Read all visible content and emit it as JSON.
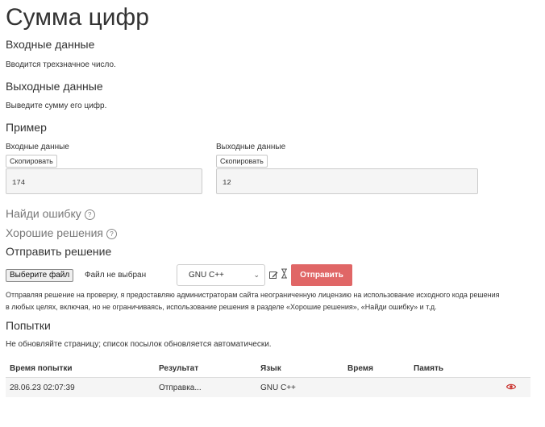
{
  "problem": {
    "title": "Сумма цифр",
    "input_heading": "Входные данные",
    "input_text": "Вводится трехзначное число.",
    "output_heading": "Выходные данные",
    "output_text": "Выведите сумму его цифр.",
    "example_heading": "Пример"
  },
  "example": {
    "input_label": "Входные данные",
    "output_label": "Выходные данные",
    "copy_label": "Скопировать",
    "input_value": "174",
    "output_value": "12"
  },
  "sections": {
    "find_error": "Найди ошибку",
    "good_solutions": "Хорошие решения",
    "submit_heading": "Отправить решение",
    "help_icon": "?"
  },
  "submit": {
    "file_button": "Выберите файл",
    "file_status": "Файл не выбран",
    "language": "GNU C++",
    "submit_label": "Отправить",
    "license_text_line1": "Отправляя решение на проверку, я предоставляю администраторам сайта неограниченную лицензию на использование исходного кода решения",
    "license_text_line2": "в любых целях, включая, но не ограничиваясь, использование решения в разделе «Хорошие решения», «Найди ошибку» и т.д."
  },
  "attempts": {
    "heading": "Попытки",
    "note": "Не обновляйте страницу; список посылок обновляется автоматически.",
    "columns": [
      "Время попытки",
      "Результат",
      "Язык",
      "Время",
      "Память"
    ],
    "rows": [
      {
        "time": "28.06.23 02:07:39",
        "result": "Отправка...",
        "language": "GNU C++",
        "runtime": "",
        "memory": ""
      }
    ]
  },
  "colors": {
    "submit_button": "#e06666",
    "eye_icon": "#c9302c"
  }
}
